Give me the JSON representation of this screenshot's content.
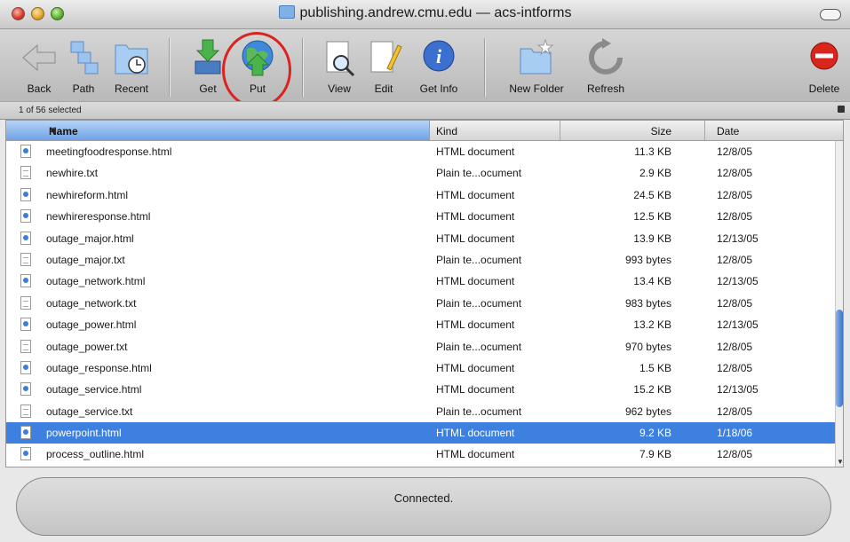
{
  "window": {
    "title": "publishing.andrew.cmu.edu — acs-intforms"
  },
  "toolbar": {
    "back": "Back",
    "path": "Path",
    "recent": "Recent",
    "get": "Get",
    "put": "Put",
    "view": "View",
    "edit": "Edit",
    "get_info": "Get Info",
    "new_folder": "New Folder",
    "refresh": "Refresh",
    "delete": "Delete"
  },
  "status": {
    "selection": "1 of 56 selected"
  },
  "columns": {
    "name": "Name",
    "kind": "Kind",
    "size": "Size",
    "date": "Date"
  },
  "files": [
    {
      "name": "meetingfoodresponse.html",
      "kind": "HTML document",
      "size": "11.3 KB",
      "date": "12/8/05",
      "type": "html"
    },
    {
      "name": "newhire.txt",
      "kind": "Plain te...ocument",
      "size": "2.9 KB",
      "date": "12/8/05",
      "type": "txt"
    },
    {
      "name": "newhireform.html",
      "kind": "HTML document",
      "size": "24.5 KB",
      "date": "12/8/05",
      "type": "html"
    },
    {
      "name": "newhireresponse.html",
      "kind": "HTML document",
      "size": "12.5 KB",
      "date": "12/8/05",
      "type": "html"
    },
    {
      "name": "outage_major.html",
      "kind": "HTML document",
      "size": "13.9 KB",
      "date": "12/13/05",
      "type": "html"
    },
    {
      "name": "outage_major.txt",
      "kind": "Plain te...ocument",
      "size": "993 bytes",
      "date": "12/8/05",
      "type": "txt"
    },
    {
      "name": "outage_network.html",
      "kind": "HTML document",
      "size": "13.4 KB",
      "date": "12/13/05",
      "type": "html"
    },
    {
      "name": "outage_network.txt",
      "kind": "Plain te...ocument",
      "size": "983 bytes",
      "date": "12/8/05",
      "type": "txt"
    },
    {
      "name": "outage_power.html",
      "kind": "HTML document",
      "size": "13.2 KB",
      "date": "12/13/05",
      "type": "html"
    },
    {
      "name": "outage_power.txt",
      "kind": "Plain te...ocument",
      "size": "970 bytes",
      "date": "12/8/05",
      "type": "txt"
    },
    {
      "name": "outage_response.html",
      "kind": "HTML document",
      "size": "1.5 KB",
      "date": "12/8/05",
      "type": "html"
    },
    {
      "name": "outage_service.html",
      "kind": "HTML document",
      "size": "15.2 KB",
      "date": "12/13/05",
      "type": "html"
    },
    {
      "name": "outage_service.txt",
      "kind": "Plain te...ocument",
      "size": "962 bytes",
      "date": "12/8/05",
      "type": "txt"
    },
    {
      "name": "powerpoint.html",
      "kind": "HTML document",
      "size": "9.2 KB",
      "date": "1/18/06",
      "type": "html",
      "selected": true
    },
    {
      "name": "process_outline.html",
      "kind": "HTML document",
      "size": "7.9 KB",
      "date": "12/8/05",
      "type": "html"
    }
  ],
  "connection": {
    "message": "Connected."
  },
  "colors": {
    "selection": "#3d80df",
    "highlight_circle": "#d9241f"
  }
}
